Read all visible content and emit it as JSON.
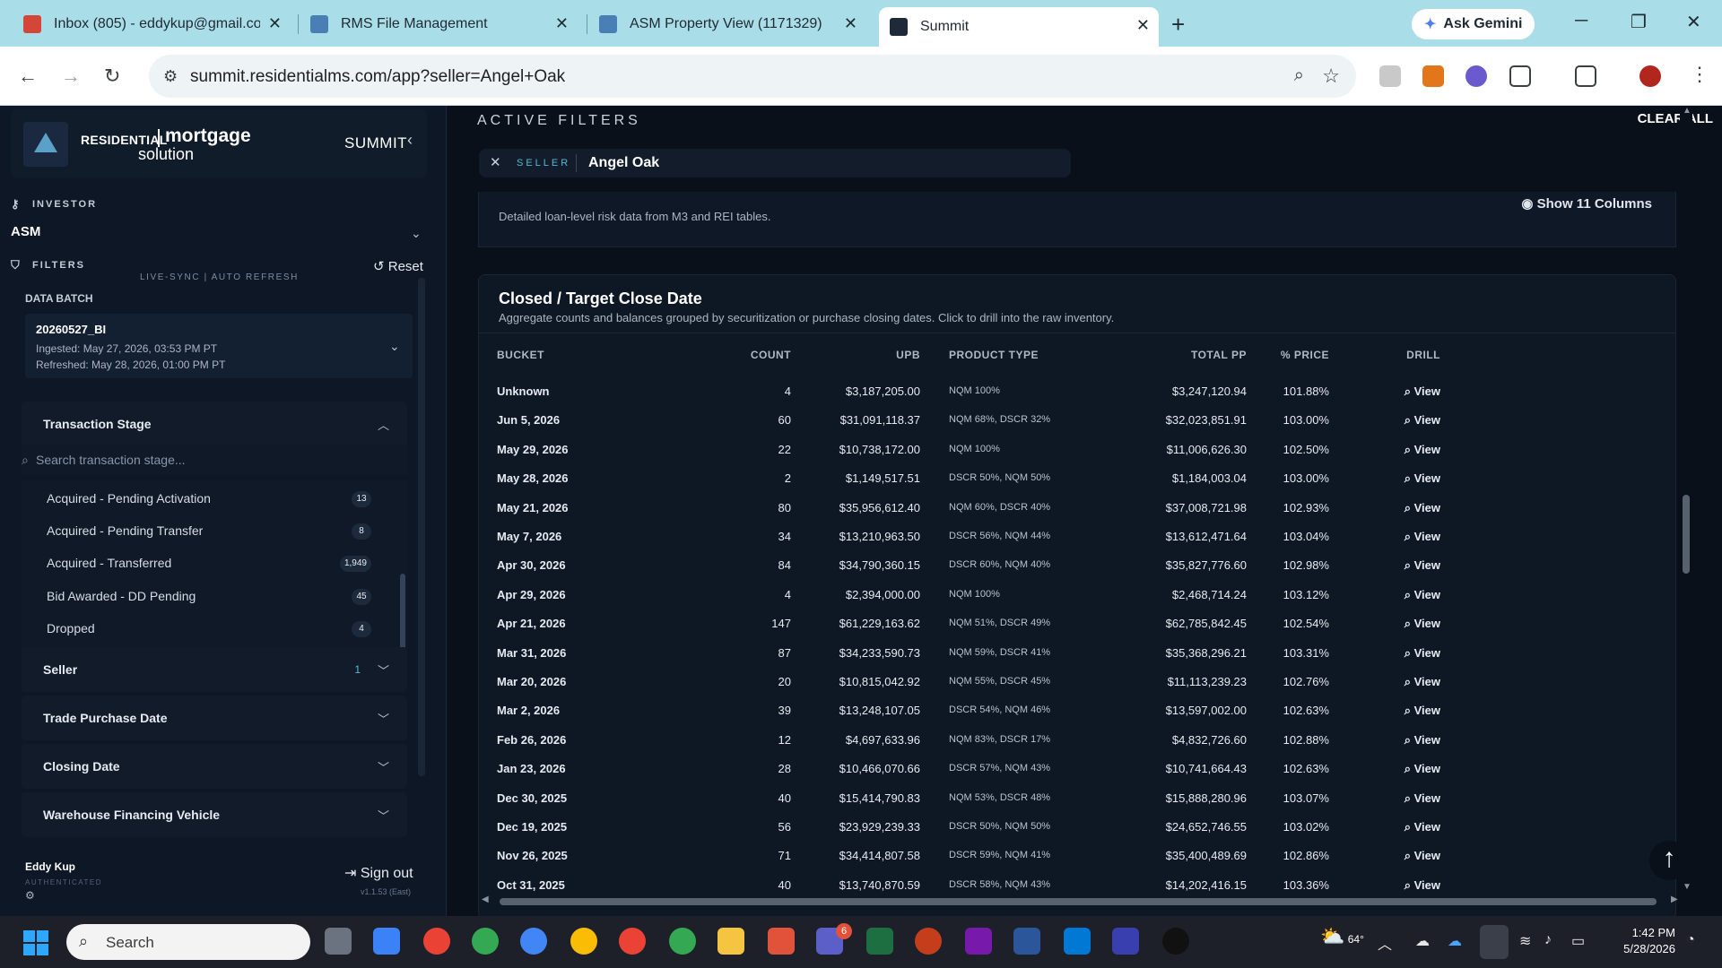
{
  "browser": {
    "tabs": [
      {
        "title": "Inbox (805) - eddykup@gmail.com",
        "favicon_color": "#d44638"
      },
      {
        "title": "RMS File Management",
        "favicon_color": "#4a7fb5"
      },
      {
        "title": "ASM Property View (1171329)",
        "favicon_color": "#4a7fb5"
      },
      {
        "title": "Summit",
        "favicon_color": "#1e2a3a"
      }
    ],
    "new_tab": "+",
    "gemini": "Ask Gemini",
    "url": "summit.residentialms.com/app?seller=Angel+Oak"
  },
  "sidebar": {
    "logo": {
      "residential": "RESIDENTIAL",
      "mortgage": "mortgage",
      "solution": "solution"
    },
    "app_name": "SUMMIT",
    "livesync": "LIVE-SYNC  |  AUTO REFRESH",
    "investor_label": "INVESTOR",
    "investor_value": "ASM",
    "filters_label": "FILTERS",
    "reset": "Reset",
    "data_batch_label": "DATA BATCH",
    "batch": {
      "name": "20260527_BI",
      "ingested": "Ingested: May 27, 2026, 03:53 PM PT",
      "refreshed": "Refreshed: May 28, 2026, 01:00 PM PT"
    },
    "transaction_stage": {
      "title": "Transaction Stage",
      "search_placeholder": "Search transaction stage...",
      "items": [
        {
          "label": "Acquired - Pending Activation",
          "count": "13"
        },
        {
          "label": "Acquired - Pending Transfer",
          "count": "8"
        },
        {
          "label": "Acquired - Transferred",
          "count": "1,949"
        },
        {
          "label": "Bid Awarded - DD Pending",
          "count": "45"
        },
        {
          "label": "Dropped",
          "count": "4"
        }
      ]
    },
    "groups": [
      {
        "title": "Seller",
        "count": "1"
      },
      {
        "title": "Trade Purchase Date",
        "count": ""
      },
      {
        "title": "Closing Date",
        "count": ""
      },
      {
        "title": "Warehouse Financing Vehicle",
        "count": ""
      }
    ],
    "user": {
      "name": "Eddy Kup",
      "status": "AUTHENTICATED",
      "sign_out": "Sign out",
      "version": "v1.1.53 (East)"
    }
  },
  "main": {
    "active_filters_title": "ACTIVE FILTERS",
    "clear_all": "CLEAR ALL",
    "chip": {
      "key": "SELLER",
      "value": "Angel Oak"
    },
    "risk_card": {
      "desc": "Detailed loan-level risk data from M3 and REI tables.",
      "show_columns": "Show 11 Columns"
    },
    "close_card": {
      "title": "Closed / Target Close Date",
      "desc": "Aggregate counts and balances grouped by securitization or purchase closing dates. Click to drill into the raw inventory.",
      "columns": [
        "BUCKET",
        "COUNT",
        "UPB",
        "PRODUCT TYPE",
        "TOTAL PP",
        "% PRICE",
        "DRILL"
      ],
      "rows": [
        {
          "bucket": "Unknown",
          "count": "4",
          "upb": "$3,187,205.00",
          "product": "NQM 100%",
          "total_pp": "$3,247,120.94",
          "price": "101.88%",
          "drill": "View"
        },
        {
          "bucket": "Jun 5, 2026",
          "count": "60",
          "upb": "$31,091,118.37",
          "product": "NQM 68%, DSCR 32%",
          "total_pp": "$32,023,851.91",
          "price": "103.00%",
          "drill": "View"
        },
        {
          "bucket": "May 29, 2026",
          "count": "22",
          "upb": "$10,738,172.00",
          "product": "NQM 100%",
          "total_pp": "$11,006,626.30",
          "price": "102.50%",
          "drill": "View"
        },
        {
          "bucket": "May 28, 2026",
          "count": "2",
          "upb": "$1,149,517.51",
          "product": "DSCR 50%, NQM 50%",
          "total_pp": "$1,184,003.04",
          "price": "103.00%",
          "drill": "View"
        },
        {
          "bucket": "May 21, 2026",
          "count": "80",
          "upb": "$35,956,612.40",
          "product": "NQM 60%, DSCR 40%",
          "total_pp": "$37,008,721.98",
          "price": "102.93%",
          "drill": "View"
        },
        {
          "bucket": "May 7, 2026",
          "count": "34",
          "upb": "$13,210,963.50",
          "product": "DSCR 56%, NQM 44%",
          "total_pp": "$13,612,471.64",
          "price": "103.04%",
          "drill": "View"
        },
        {
          "bucket": "Apr 30, 2026",
          "count": "84",
          "upb": "$34,790,360.15",
          "product": "DSCR 60%, NQM 40%",
          "total_pp": "$35,827,776.60",
          "price": "102.98%",
          "drill": "View"
        },
        {
          "bucket": "Apr 29, 2026",
          "count": "4",
          "upb": "$2,394,000.00",
          "product": "NQM 100%",
          "total_pp": "$2,468,714.24",
          "price": "103.12%",
          "drill": "View"
        },
        {
          "bucket": "Apr 21, 2026",
          "count": "147",
          "upb": "$61,229,163.62",
          "product": "NQM 51%, DSCR 49%",
          "total_pp": "$62,785,842.45",
          "price": "102.54%",
          "drill": "View"
        },
        {
          "bucket": "Mar 31, 2026",
          "count": "87",
          "upb": "$34,233,590.73",
          "product": "NQM 59%, DSCR 41%",
          "total_pp": "$35,368,296.21",
          "price": "103.31%",
          "drill": "View"
        },
        {
          "bucket": "Mar 20, 2026",
          "count": "20",
          "upb": "$10,815,042.92",
          "product": "NQM 55%, DSCR 45%",
          "total_pp": "$11,113,239.23",
          "price": "102.76%",
          "drill": "View"
        },
        {
          "bucket": "Mar 2, 2026",
          "count": "39",
          "upb": "$13,248,107.05",
          "product": "DSCR 54%, NQM 46%",
          "total_pp": "$13,597,002.00",
          "price": "102.63%",
          "drill": "View"
        },
        {
          "bucket": "Feb 26, 2026",
          "count": "12",
          "upb": "$4,697,633.96",
          "product": "NQM 83%, DSCR 17%",
          "total_pp": "$4,832,726.60",
          "price": "102.88%",
          "drill": "View"
        },
        {
          "bucket": "Jan 23, 2026",
          "count": "28",
          "upb": "$10,466,070.66",
          "product": "DSCR 57%, NQM 43%",
          "total_pp": "$10,741,664.43",
          "price": "102.63%",
          "drill": "View"
        },
        {
          "bucket": "Dec 30, 2025",
          "count": "40",
          "upb": "$15,414,790.83",
          "product": "NQM 53%, DSCR 48%",
          "total_pp": "$15,888,280.96",
          "price": "103.07%",
          "drill": "View"
        },
        {
          "bucket": "Dec 19, 2025",
          "count": "56",
          "upb": "$23,929,239.33",
          "product": "DSCR 50%, NQM 50%",
          "total_pp": "$24,652,746.55",
          "price": "103.02%",
          "drill": "View"
        },
        {
          "bucket": "Nov 26, 2025",
          "count": "71",
          "upb": "$34,414,807.58",
          "product": "DSCR 59%, NQM 41%",
          "total_pp": "$35,400,489.69",
          "price": "102.86%",
          "drill": "View"
        },
        {
          "bucket": "Oct 31, 2025",
          "count": "40",
          "upb": "$13,740,870.59",
          "product": "DSCR 58%, NQM 43%",
          "total_pp": "$14,202,416.15",
          "price": "103.36%",
          "drill": "View"
        }
      ]
    }
  },
  "taskbar": {
    "search": "Search",
    "weather": "64°",
    "notification_count": "6",
    "time": "1:42 PM",
    "date": "5/28/2026"
  }
}
